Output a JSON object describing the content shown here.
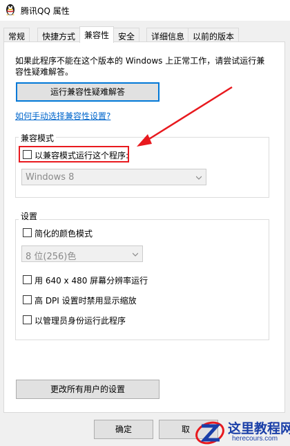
{
  "window": {
    "title": "腾讯QQ 属性",
    "icon": "qq-penguin-icon"
  },
  "tabs": [
    {
      "label": "常规"
    },
    {
      "label": "快捷方式"
    },
    {
      "label": "兼容性",
      "active": true
    },
    {
      "label": "安全"
    },
    {
      "label": "详细信息"
    },
    {
      "label": "以前的版本"
    }
  ],
  "compat": {
    "intro_line1": "如果此程序不能在这个版本的 Windows 上正常工作，请尝试运行兼",
    "intro_line2": "容性疑难解答。",
    "troubleshooter_button": "运行兼容性疑难解答",
    "manual_link": "如何手动选择兼容性设置?",
    "mode_group_label": "兼容模式",
    "mode_checkbox_label": "以兼容模式运行这个程序:",
    "mode_select_value": "Windows 8",
    "settings_group_label": "设置",
    "reduced_color_label": "简化的颜色模式",
    "color_select_value": "8 位(256)色",
    "res_640_label": "用 640 x 480 屏幕分辨率运行",
    "high_dpi_label": "高 DPI 设置时禁用显示缩放",
    "admin_label": "以管理员身份运行此程序",
    "all_users_button": "更改所有用户的设置"
  },
  "footer": {
    "ok_button": "确定",
    "cancel_button_partial": "取"
  },
  "watermark": {
    "text_main": "这里教程网",
    "text_url": "herecours.com"
  },
  "colors": {
    "accent": "#0078d7",
    "link": "#0066cc",
    "annotation_red": "#e8191e"
  }
}
